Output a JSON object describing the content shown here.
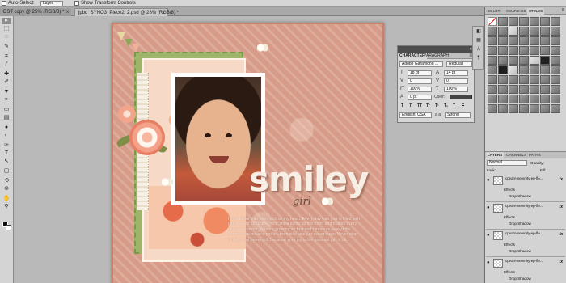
{
  "options_bar": {
    "auto_select_label": "Auto-Select:",
    "auto_select_value": "Layer",
    "show_transform_label": "Show Transform Controls"
  },
  "doc_tabs": [
    {
      "label": "DST copy @ 25% (RGB/8) *",
      "close": "x"
    },
    {
      "label": "jpbd_SYNO3_Piece2_2.psd @ 28% (RGB/8) *",
      "close": "x"
    }
  ],
  "toolbox": {
    "tools": [
      {
        "icon": "move-icon",
        "glyph": "▸"
      },
      {
        "icon": "marquee-icon",
        "glyph": "⬚"
      },
      {
        "icon": "lasso-icon",
        "glyph": "◌"
      },
      {
        "icon": "quick-select-icon",
        "glyph": "✎"
      },
      {
        "icon": "crop-icon",
        "glyph": "⌗"
      },
      {
        "icon": "eyedropper-icon",
        "glyph": "⁄"
      },
      {
        "icon": "healing-icon",
        "glyph": "✚"
      },
      {
        "icon": "brush-icon",
        "glyph": "✐"
      },
      {
        "icon": "stamp-icon",
        "glyph": "▼"
      },
      {
        "icon": "history-brush-icon",
        "glyph": "✒"
      },
      {
        "icon": "eraser-icon",
        "glyph": "▭"
      },
      {
        "icon": "gradient-icon",
        "glyph": "▤"
      },
      {
        "icon": "blur-icon",
        "glyph": "●"
      },
      {
        "icon": "dodge-icon",
        "glyph": "◐"
      },
      {
        "icon": "pen-icon",
        "glyph": "✑"
      },
      {
        "icon": "type-icon",
        "glyph": "T"
      },
      {
        "icon": "path-select-icon",
        "glyph": "↖"
      },
      {
        "icon": "shape-icon",
        "glyph": "▢"
      },
      {
        "icon": "3d-rotate-icon",
        "glyph": "⟲"
      },
      {
        "icon": "3d-orbit-icon",
        "glyph": "⊚"
      },
      {
        "icon": "hand-icon",
        "glyph": "✋"
      },
      {
        "icon": "zoom-icon",
        "glyph": "⚲"
      }
    ],
    "foreground_color": "#111111",
    "background_color": "#ffffff"
  },
  "canvas": {
    "title_word": "smiley",
    "subtitle_word": "girl",
    "journal_text": "I love these little ones with all my heart. Every day with you is filled with giggles and sunshine. Your smile lights up the room and makes every moment special. You are growing so fast and I treasure every little memory we make together, from silly faces to sweet hugs. Never stop smiling, my sweet girl, because your joy is the greatest gift of all."
  },
  "character_panel": {
    "tab_character": "CHARACTER",
    "tab_paragraph": "PARAGRAPH",
    "menu": "≡",
    "collapse": "«",
    "font_family": "Adobe Garamond ...",
    "font_style": "Regular",
    "font_size": "18 pt",
    "leading": "14 pt",
    "kerning": "0",
    "tracking": "0",
    "vertical_scale": "100%",
    "horizontal_scale": "100%",
    "baseline_shift": "0 pt",
    "color_label": "Color:",
    "type_styles": [
      "T",
      "T",
      "TT",
      "Tr",
      "T¹",
      "T₁",
      "T",
      "T"
    ],
    "language": "English: USA",
    "antialias": "Strong",
    "antialias_prefix": "a a"
  },
  "dock_icons": [
    "◧",
    "▦",
    "A",
    "¶"
  ],
  "styles_panel": {
    "tab_color": "COLOR",
    "tab_swatches": "SWATCHES",
    "tab_styles": "STYLES",
    "menu": "≡"
  },
  "layers_panel": {
    "tab_layers": "LAYERS",
    "tab_channels": "CHANNELS",
    "tab_paths": "PATHS",
    "blend_mode": "Normal",
    "opacity_label": "Opacity:",
    "lock_label": "Lock:",
    "fill_label": "Fill:",
    "layers": [
      {
        "name": "cpearn-serenity-ep-flo...",
        "fx": "fx",
        "effects": "Effects",
        "effect": "Drop Shadow"
      },
      {
        "name": "cpearn-serenity-ep-flo...",
        "fx": "fx",
        "effects": "Effects",
        "effect": "Drop Shadow"
      },
      {
        "name": "cpearn-serenity-ep-flo...",
        "fx": "fx",
        "effects": "Effects",
        "effect": "Drop Shadow"
      },
      {
        "name": "cpearn-serenity-ep-flo...",
        "fx": "fx",
        "effects": "Effects",
        "effect": "Drop Shadow"
      }
    ]
  }
}
